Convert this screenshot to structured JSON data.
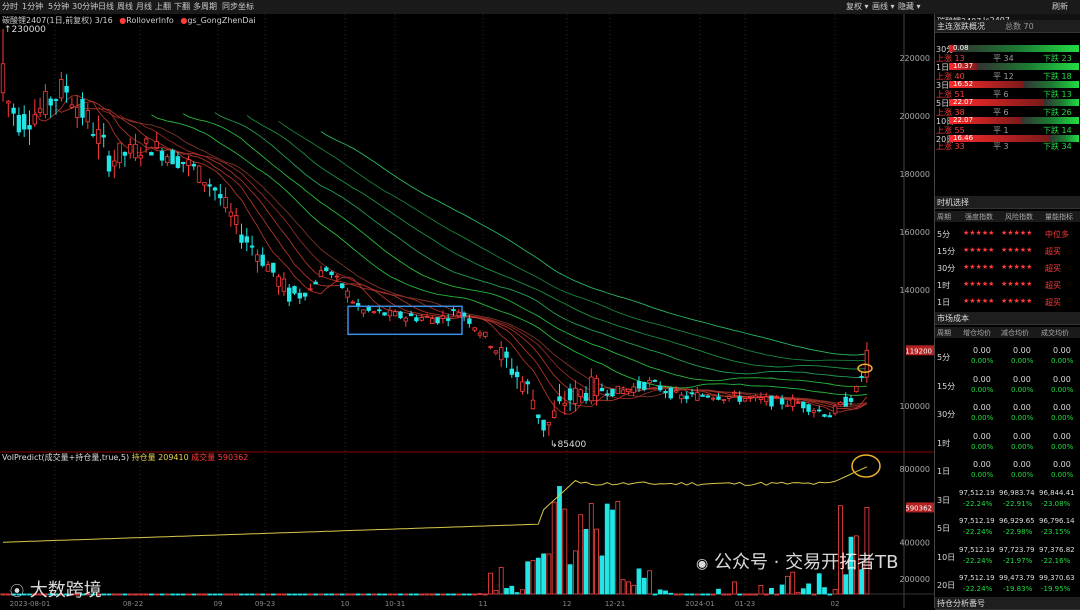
{
  "toolbar": {
    "periods": [
      "分时",
      "1分钟",
      "5分钟",
      "30分钟",
      "日线",
      "周线",
      "月线",
      "上翻",
      "下翻",
      "多周期",
      "同步坐标"
    ],
    "right": [
      "复权 ▾",
      "画线 ▾",
      "隐藏 ▾",
      "刷新"
    ]
  },
  "chart": {
    "title": "碳酸锂2407(1日,前复权) 3/16",
    "ind1": "RolloverInfo",
    "ind2": "gs_GongZhenDai",
    "high_label": "230000",
    "low_label": "85400",
    "price_axis": [
      "220000",
      "200000",
      "180000",
      "160000",
      "140000",
      "100000"
    ],
    "price_tag": "119200",
    "vol_title": "VolPredict(成交量+持仓量,true,5)",
    "oi_label": "持仓量",
    "oi_value": "209410",
    "vol_label": "成交量",
    "vol_value": "590362",
    "vol_axis": [
      "800000",
      "400000",
      "200000"
    ],
    "vol_tag": "590362",
    "dates": [
      "2023-08-01",
      "08-22",
      "09",
      "09-23",
      "10",
      "10-31",
      "11",
      "12",
      "12-21",
      "2024-01",
      "01-23",
      "02"
    ]
  },
  "panel": {
    "title": "碳酸锂2407",
    "code": "lc2407",
    "refresh": "刷新",
    "sec1": "主连涨跌概况",
    "sec1_total": "总数 70",
    "breadth": [
      {
        "period": "30分",
        "up": "",
        "flat": "",
        "down": "",
        "bar": "0.08",
        "red_frac": 0.05
      },
      {
        "period": "1日",
        "up": "上涨 13",
        "flat": "平 34",
        "down": "下跌 23",
        "bar": "10.37",
        "red_frac": 0.22
      },
      {
        "period": "3日",
        "up": "上涨 40",
        "flat": "平 12",
        "down": "下跌 18",
        "bar": "16.52",
        "red_frac": 0.58
      },
      {
        "period": "5日",
        "up": "上涨 51",
        "flat": "平 6",
        "down": "下跌 13",
        "bar": "22.07",
        "red_frac": 0.73
      },
      {
        "period": "10日",
        "up": "上涨 38",
        "flat": "平 6",
        "down": "下跌 26",
        "bar": "22.07",
        "red_frac": 0.55
      },
      {
        "period": "20日",
        "up": "上涨 55",
        "flat": "平 1",
        "down": "下跌 14",
        "bar": "16.46",
        "red_frac": 0.77
      },
      {
        "period": "",
        "up": "上涨 33",
        "flat": "平 3",
        "down": "下跌 34",
        "bar": "",
        "red_frac": 0
      }
    ],
    "sec2": "时机选择",
    "timing_cols": [
      "周期",
      "强度指数",
      "风险指数",
      "量能指标"
    ],
    "timing": [
      {
        "period": "5分",
        "s1": "★★★★★",
        "s2": "★★★★★",
        "signal": "中位多"
      },
      {
        "period": "15分",
        "s1": "★★★★★",
        "s2": "★★★★★",
        "signal": "超买"
      },
      {
        "period": "30分",
        "s1": "★★★★★",
        "s2": "★★★★★",
        "signal": "超买"
      },
      {
        "period": "1时",
        "s1": "★★★★★",
        "s2": "★★★★★",
        "signal": "超买"
      },
      {
        "period": "1日",
        "s1": "★★★★★",
        "s2": "★★★★★",
        "signal": "超买"
      }
    ],
    "sec3": "市场成本",
    "cost_cols": [
      "周期",
      "增仓均价",
      "减仓均价",
      "成交均价"
    ],
    "cost": [
      {
        "period": "5分",
        "a": "0.00",
        "b": "0.00",
        "c": "0.00",
        "pa": "0.00%",
        "pb": "0.00%",
        "pc": "0.00%"
      },
      {
        "period": "15分",
        "a": "0.00",
        "b": "0.00",
        "c": "0.00",
        "pa": "0.00%",
        "pb": "0.00%",
        "pc": "0.00%"
      },
      {
        "period": "30分",
        "a": "0.00",
        "b": "0.00",
        "c": "0.00",
        "pa": "0.00%",
        "pb": "0.00%",
        "pc": "0.00%"
      },
      {
        "period": "1时",
        "a": "0.00",
        "b": "0.00",
        "c": "0.00",
        "pa": "0.00%",
        "pb": "0.00%",
        "pc": "0.00%"
      },
      {
        "period": "1日",
        "a": "0.00",
        "b": "0.00",
        "c": "0.00",
        "pa": "0.00%",
        "pb": "0.00%",
        "pc": "0.00%"
      },
      {
        "period": "3日",
        "a": "97,512.19",
        "b": "96,983.74",
        "c": "96,844.41",
        "pa": "-22.24%",
        "pb": "-22.91%",
        "pc": "-23.08%"
      },
      {
        "period": "5日",
        "a": "97,512.19",
        "b": "96,929.65",
        "c": "96,796.14",
        "pa": "-22.24%",
        "pb": "-22.98%",
        "pc": "-23.15%"
      },
      {
        "period": "10日",
        "a": "97,512.19",
        "b": "97,723.79",
        "c": "97,376.82",
        "pa": "-22.24%",
        "pb": "-21.97%",
        "pc": "-22.16%"
      },
      {
        "period": "20日",
        "a": "97,512.19",
        "b": "99,473.79",
        "c": "99,370.63",
        "pa": "-22.24%",
        "pb": "-19.83%",
        "pc": "-19.95%"
      }
    ],
    "sec4": "持仓分析番号"
  },
  "watermark": {
    "left": "大数跨境",
    "right": "公众号 · 交易开拓者TB"
  },
  "colors": {
    "up": "#ff3b3b",
    "down": "#22e5e5",
    "vol_up": "#ff4444",
    "vol_down": "#22e5e5",
    "oi_line": "#d8c84a",
    "ribbon_red": "#c0392b",
    "ribbon_green": "#2ecc40",
    "highlight": "#3a8ee6",
    "circle": "#f0b429"
  }
}
